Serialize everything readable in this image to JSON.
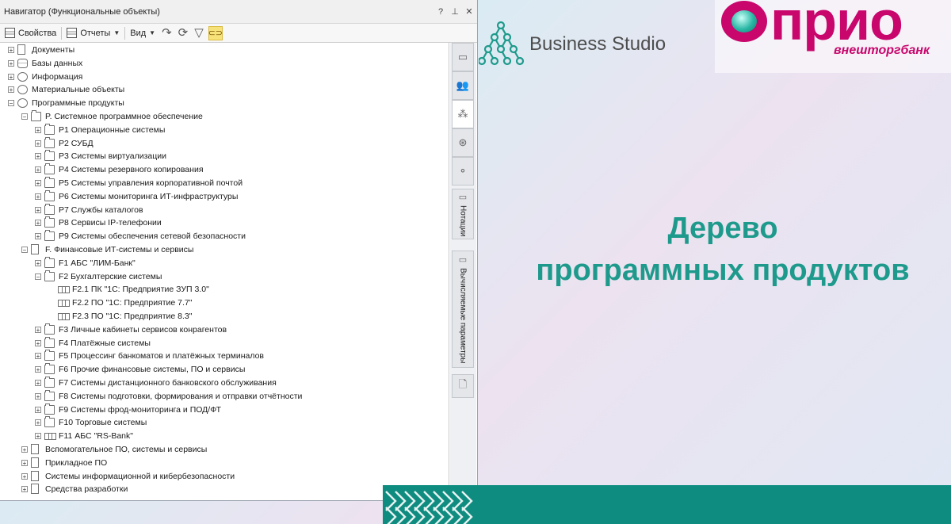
{
  "navigator": {
    "title": "Навигатор (Функциональные объекты)",
    "title_buttons": [
      "?",
      "⊥",
      "✕"
    ],
    "toolbar": {
      "properties": "Свойства",
      "reports": "Отчеты",
      "view": "Вид"
    },
    "tree": [
      {
        "label": "Документы",
        "level": 0,
        "icon": "doc-icon",
        "expander": "+"
      },
      {
        "label": "Базы данных",
        "level": 0,
        "icon": "database-icon",
        "expander": "+"
      },
      {
        "label": "Информация",
        "level": 0,
        "icon": "info-icon",
        "expander": "+"
      },
      {
        "label": "Материальные объекты",
        "level": 0,
        "icon": "cube-icon",
        "expander": "+"
      },
      {
        "label": "Программные продукты",
        "level": 0,
        "icon": "software-icon",
        "expander": "−"
      },
      {
        "label": "P. Системное программное обеспечение",
        "level": 1,
        "icon": "folder-icon",
        "expander": "−"
      },
      {
        "label": "P1 Операционные системы",
        "level": 2,
        "icon": "folder-icon",
        "expander": "+"
      },
      {
        "label": "P2 СУБД",
        "level": 2,
        "icon": "folder-icon",
        "expander": "+"
      },
      {
        "label": "P3 Системы виртуализации",
        "level": 2,
        "icon": "folder-icon",
        "expander": "+"
      },
      {
        "label": "P4 Системы резервного копирования",
        "level": 2,
        "icon": "folder-icon",
        "expander": "+"
      },
      {
        "label": "P5 Системы управления корпоративной почтой",
        "level": 2,
        "icon": "folder-icon",
        "expander": "+"
      },
      {
        "label": "P6 Системы мониторинга ИТ-инфраструктуры",
        "level": 2,
        "icon": "folder-icon",
        "expander": "+"
      },
      {
        "label": "P7 Службы каталогов",
        "level": 2,
        "icon": "folder-icon",
        "expander": "+"
      },
      {
        "label": "P8 Сервисы IP-телефонии",
        "level": 2,
        "icon": "folder-icon",
        "expander": "+"
      },
      {
        "label": "P9 Системы обеспечения сетевой безопасности",
        "level": 2,
        "icon": "folder-icon",
        "expander": "+"
      },
      {
        "label": "F. Финансовые ИТ-системы и сервисы",
        "level": 1,
        "icon": "doc-icon",
        "expander": "−"
      },
      {
        "label": "F1 АБС \"ЛИМ-Банк\"",
        "level": 2,
        "icon": "folder-icon",
        "expander": "+"
      },
      {
        "label": "F2 Бухгалтерские системы",
        "level": 2,
        "icon": "folder-icon",
        "expander": "−"
      },
      {
        "label": "F2.1 ПК \"1С: Предприятие ЗУП 3.0\"",
        "level": 3,
        "icon": "app-icon",
        "expander": ""
      },
      {
        "label": "F2.2 ПО \"1С: Предприятие 7.7\"",
        "level": 3,
        "icon": "app-icon",
        "expander": ""
      },
      {
        "label": "F2.3 ПО \"1С: Предприятие 8.3\"",
        "level": 3,
        "icon": "app-icon",
        "expander": ""
      },
      {
        "label": "F3 Личные кабинеты сервисов конрагентов",
        "level": 2,
        "icon": "folder-icon",
        "expander": "+"
      },
      {
        "label": "F4 Платёжные системы",
        "level": 2,
        "icon": "folder-icon",
        "expander": "+"
      },
      {
        "label": "F5 Процессинг банкоматов и платёжных терминалов",
        "level": 2,
        "icon": "folder-icon",
        "expander": "+"
      },
      {
        "label": "F6 Прочие финансовые системы, ПО и сервисы",
        "level": 2,
        "icon": "folder-icon",
        "expander": "+"
      },
      {
        "label": "F7 Системы дистанционного банковского обслуживания",
        "level": 2,
        "icon": "folder-icon",
        "expander": "+"
      },
      {
        "label": "F8 Системы подготовки, формирования и отправки отчётности",
        "level": 2,
        "icon": "folder-icon",
        "expander": "+"
      },
      {
        "label": "F9 Системы фрод-мониторинга и ПОД/ФТ",
        "level": 2,
        "icon": "folder-icon",
        "expander": "+"
      },
      {
        "label": "F10 Торговые системы",
        "level": 2,
        "icon": "folder-icon",
        "expander": "+"
      },
      {
        "label": "F11 АБС \"RS-Bank\"",
        "level": 2,
        "icon": "app-icon",
        "expander": "+"
      },
      {
        "label": "Вспомогательное ПО, системы и сервисы",
        "level": 1,
        "icon": "doc-icon",
        "expander": "+"
      },
      {
        "label": "Прикладное ПО",
        "level": 1,
        "icon": "doc-icon",
        "expander": "+"
      },
      {
        "label": "Системы информационной и кибербезопасности",
        "level": 1,
        "icon": "doc-icon",
        "expander": "+"
      },
      {
        "label": "Средства разработки",
        "level": 1,
        "icon": "doc-icon",
        "expander": "+"
      }
    ],
    "side_tabs": {
      "notations": "Нотации",
      "computed_params": "Вычисляемые параметры"
    }
  },
  "branding": {
    "business_studio": "Business Studio",
    "prio_word": "прио",
    "prio_sub": "внешторгбанк"
  },
  "headline": {
    "line1": "Дерево",
    "line2": "программных продуктов"
  },
  "colors": {
    "accent_teal": "#1e9a8c",
    "brand_magenta": "#c8066c",
    "band_teal": "#0f8c80"
  }
}
